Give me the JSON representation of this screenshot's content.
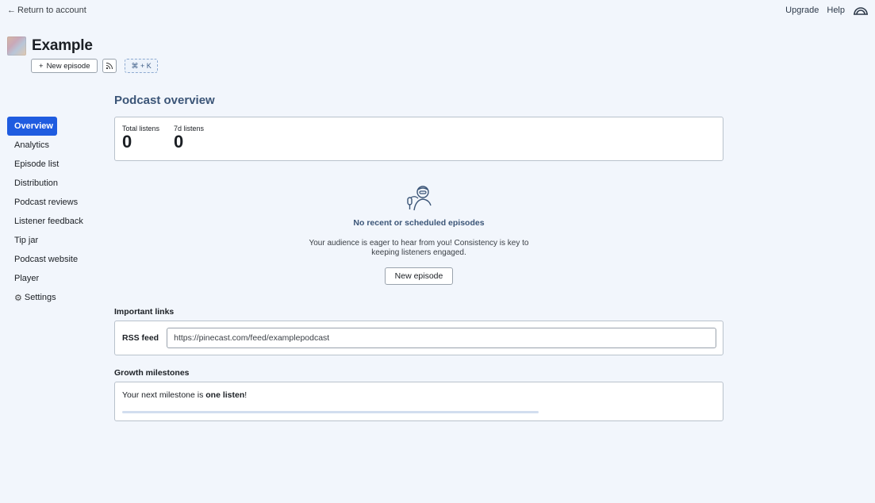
{
  "topbar": {
    "back_label": "Return to account",
    "upgrade_label": "Upgrade",
    "help_label": "Help"
  },
  "podcast": {
    "title": "Example",
    "new_episode_label": "New episode",
    "shortcut_label": "⌘ + K"
  },
  "sidebar": {
    "items": [
      {
        "label": "Overview",
        "active": true
      },
      {
        "label": "Analytics"
      },
      {
        "label": "Episode list"
      },
      {
        "label": "Distribution"
      },
      {
        "label": "Podcast reviews"
      },
      {
        "label": "Listener feedback"
      },
      {
        "label": "Tip jar"
      },
      {
        "label": "Podcast website"
      },
      {
        "label": "Player"
      },
      {
        "label": "Settings",
        "icon": "gear-icon"
      }
    ]
  },
  "main": {
    "title": "Podcast overview",
    "stats": [
      {
        "label": "Total listens",
        "value": "0"
      },
      {
        "label": "7d listens",
        "value": "0"
      }
    ],
    "empty": {
      "icon": "microphone-person-icon",
      "title": "No recent or scheduled episodes",
      "text": "Your audience is eager to hear from you! Consistency is key to keeping listeners engaged.",
      "button_label": "New episode"
    },
    "links": {
      "section_label": "Important links",
      "rss_label": "RSS feed",
      "rss_value": "https://pinecast.com/feed/examplepodcast"
    },
    "milestones": {
      "section_label": "Growth milestones",
      "text_prefix": "Your next milestone is ",
      "text_bold": "one listen",
      "text_suffix": "!",
      "progress": 0
    }
  },
  "colors": {
    "accent": "#1f5ce0",
    "heading": "#3b5577",
    "background": "#f2f6fc"
  }
}
